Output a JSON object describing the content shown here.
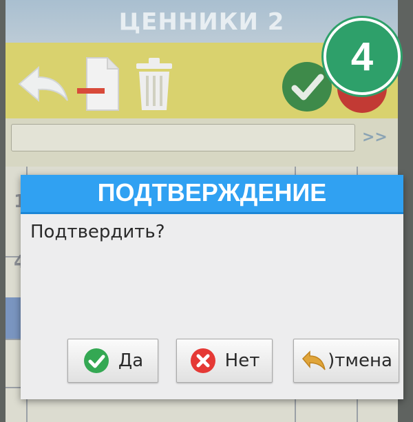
{
  "window": {
    "title": "ЦЕННИКИ 2"
  },
  "toolbar": {
    "back_icon": "back-arrow-icon",
    "document_icon": "document-remove-icon",
    "delete_icon": "trash-icon",
    "confirm_icon": "checkmark-icon",
    "cancel_icon": "cancel-icon"
  },
  "search": {
    "next_label": ">>"
  },
  "list": {
    "row_numbers": [
      "1",
      "4"
    ]
  },
  "dialog": {
    "title": "ПОДТВЕРЖДЕНИЕ",
    "message": "Подтвердить?",
    "buttons": {
      "yes": "Да",
      "no": "Нет",
      "cancel": ")тмена"
    }
  },
  "badge": {
    "step": "4"
  },
  "colors": {
    "dialog_header": "#30a1f2",
    "toolbar": "#d9d26e",
    "badge": "#2ea06a",
    "yes_icon": "#34a853",
    "no_icon": "#e53935"
  }
}
